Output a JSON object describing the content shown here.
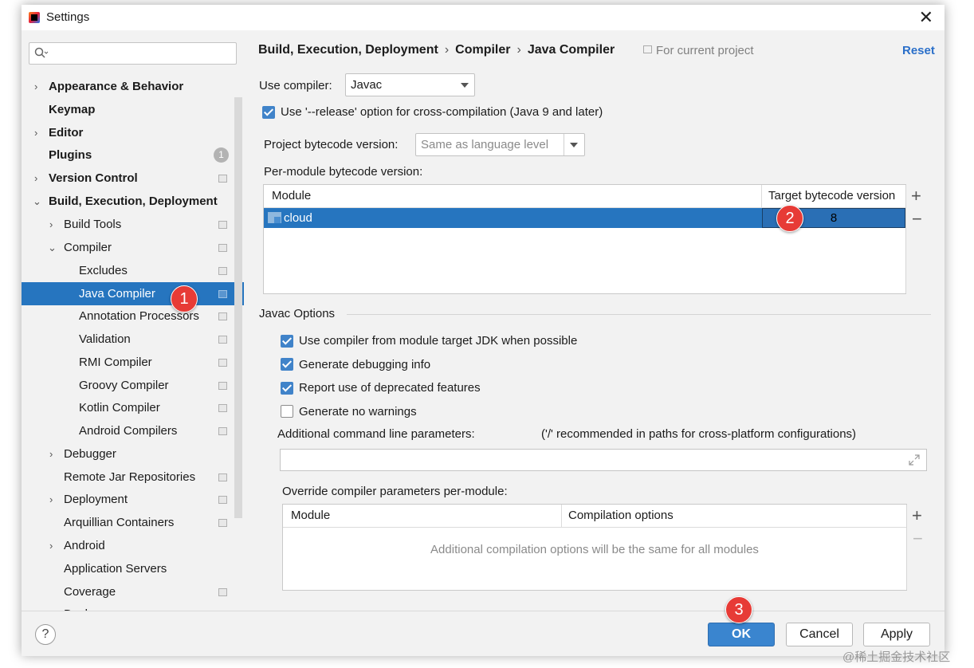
{
  "window": {
    "title": "Settings",
    "close": "✕"
  },
  "sidebar": {
    "items": [
      {
        "label": "Appearance & Behavior",
        "arrow": "›"
      },
      {
        "label": "Keymap"
      },
      {
        "label": "Editor",
        "arrow": "›"
      },
      {
        "label": "Plugins",
        "badge": "1"
      },
      {
        "label": "Version Control",
        "arrow": "›"
      },
      {
        "label": "Build, Execution, Deployment",
        "arrow": "⌄"
      },
      {
        "label": "Build Tools",
        "arrow": "›"
      },
      {
        "label": "Compiler",
        "arrow": "⌄"
      },
      {
        "label": "Excludes"
      },
      {
        "label": "Java Compiler"
      },
      {
        "label": "Annotation Processors"
      },
      {
        "label": "Validation"
      },
      {
        "label": "RMI Compiler"
      },
      {
        "label": "Groovy Compiler"
      },
      {
        "label": "Kotlin Compiler"
      },
      {
        "label": "Android Compilers"
      },
      {
        "label": "Debugger",
        "arrow": "›"
      },
      {
        "label": "Remote Jar Repositories"
      },
      {
        "label": "Deployment",
        "arrow": "›"
      },
      {
        "label": "Arquillian Containers"
      },
      {
        "label": "Android",
        "arrow": "›"
      },
      {
        "label": "Application Servers"
      },
      {
        "label": "Coverage"
      },
      {
        "label": "Docker",
        "arrow": "›"
      }
    ]
  },
  "breadcrumb": [
    "Build, Execution, Deployment",
    "Compiler",
    "Java Compiler"
  ],
  "breadcrumb_sep": "›",
  "for_current_project": "For current project",
  "reset": "Reset",
  "use_compiler": {
    "label": "Use compiler:",
    "value": "Javac"
  },
  "release_option": "Use '--release' option for cross-compilation (Java 9 and later)",
  "project_bytecode": {
    "label": "Project bytecode version:",
    "value": "Same as language level"
  },
  "per_module": {
    "label": "Per-module bytecode version:",
    "col_module": "Module",
    "col_target": "Target bytecode version",
    "rows": [
      {
        "module": "cloud",
        "target": "8"
      }
    ]
  },
  "javac": {
    "section": "Javac Options",
    "opts": [
      {
        "label": "Use compiler from module target JDK when possible",
        "checked": true
      },
      {
        "label": "Generate debugging info",
        "checked": true
      },
      {
        "label": "Report use of deprecated features",
        "checked": true
      },
      {
        "label": "Generate no warnings",
        "checked": false
      }
    ],
    "additional_label": "Additional command line parameters:",
    "additional_hint": "('/' recommended in paths for cross-platform configurations)",
    "additional_value": "",
    "override_label": "Override compiler parameters per-module:",
    "col_module": "Module",
    "col_options": "Compilation options",
    "empty_text": "Additional compilation options will be the same for all modules"
  },
  "buttons": {
    "ok": "OK",
    "cancel": "Cancel",
    "apply": "Apply",
    "help": "?"
  },
  "tools": {
    "plus": "+",
    "minus": "−"
  },
  "markers": [
    "1",
    "2",
    "3"
  ],
  "watermark": "@稀土掘金技术社区",
  "colors": {
    "selection": "#2675bf",
    "accent": "#3a85cf",
    "marker": "#e73b36",
    "link": "#2a6fc9"
  }
}
